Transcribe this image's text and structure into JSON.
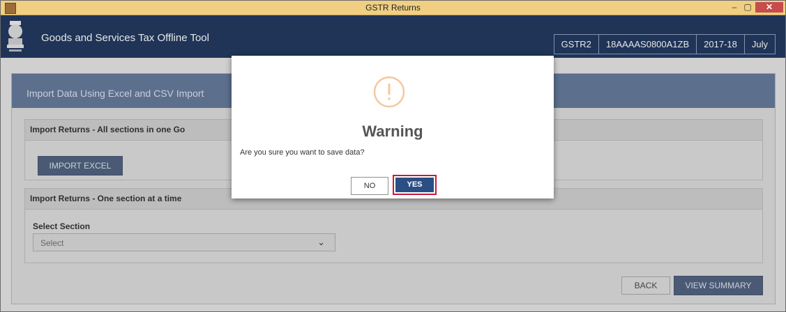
{
  "window": {
    "title": "GSTR Returns"
  },
  "header": {
    "app_title": "Goods and Services Tax Offline Tool",
    "tags": [
      "GSTR2",
      "18AAAAS0800A1ZB",
      "2017-18",
      "July"
    ]
  },
  "main": {
    "section_title": "Import Data Using Excel and CSV Import",
    "panel1": {
      "heading": "Import Returns - All sections in one Go",
      "button_label": "IMPORT EXCEL"
    },
    "panel2": {
      "heading": "Import Returns - One section at a time",
      "select_label": "Select Section",
      "select_value": "Select"
    },
    "back_label": "BACK",
    "view_summary_label": "VIEW SUMMARY"
  },
  "modal": {
    "title": "Warning",
    "message": "Are you sure you want to save data?",
    "no_label": "NO",
    "yes_label": "YES"
  },
  "colors": {
    "accent_dark": "#1f3457",
    "warning_icon": "#f5c79e",
    "yes_highlight": "#c8193c"
  }
}
